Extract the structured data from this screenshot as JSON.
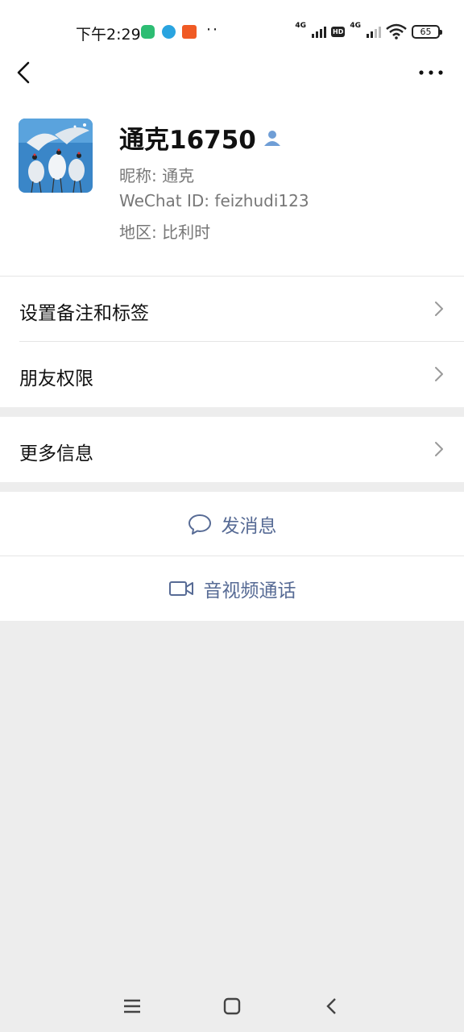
{
  "status_bar": {
    "time": "下午2:29",
    "battery": "65",
    "network1": "4G",
    "network2": "4G",
    "hd": "HD"
  },
  "nav": {
    "back_icon": "back-arrow-icon",
    "more_icon": "more-dots-icon"
  },
  "profile": {
    "name": "通克16750",
    "nickname": "昵称:  通克",
    "wechat_id": "WeChat ID:  feizhudi123",
    "region": "地区:  比利时"
  },
  "menu": {
    "remarks_tags": "设置备注和标签",
    "friend_permissions": "朋友权限",
    "more_info": "更多信息"
  },
  "actions": {
    "send_message": "发消息",
    "video_call": "音视频通话"
  },
  "colors": {
    "link_blue": "#576b95",
    "background": "#ededed"
  }
}
